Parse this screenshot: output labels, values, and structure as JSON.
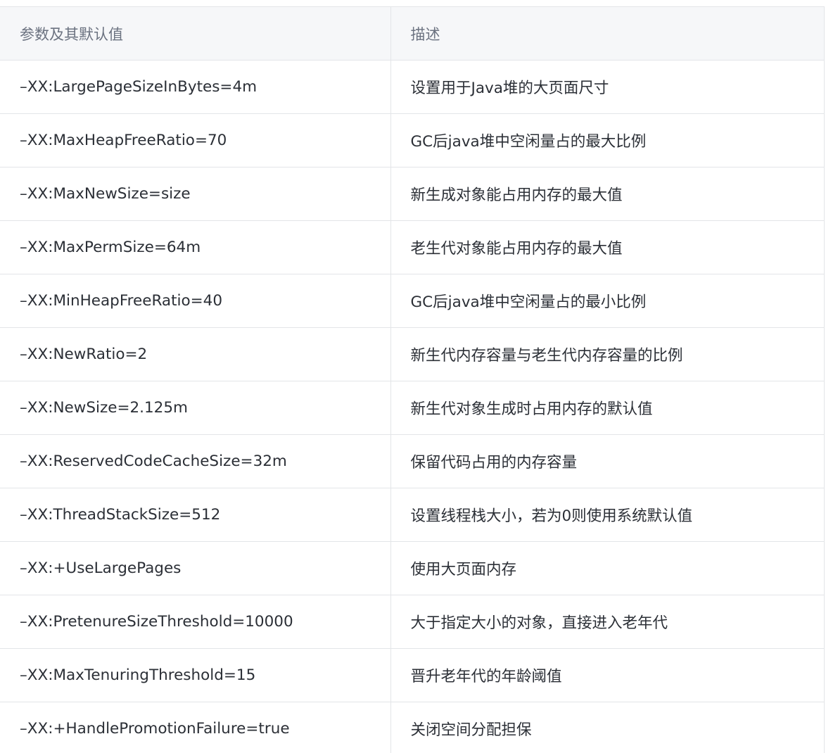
{
  "table": {
    "headers": [
      "参数及其默认值",
      "描述"
    ],
    "rows": [
      [
        "–XX:LargePageSizeInBytes=4m",
        "设置用于Java堆的大页面尺寸"
      ],
      [
        "–XX:MaxHeapFreeRatio=70",
        "GC后java堆中空闲量占的最大比例"
      ],
      [
        "–XX:MaxNewSize=size",
        "新生成对象能占用内存的最大值"
      ],
      [
        "–XX:MaxPermSize=64m",
        "老生代对象能占用内存的最大值"
      ],
      [
        "–XX:MinHeapFreeRatio=40",
        "GC后java堆中空闲量占的最小比例"
      ],
      [
        "–XX:NewRatio=2",
        "新生代内存容量与老生代内存容量的比例"
      ],
      [
        "–XX:NewSize=2.125m",
        "新生代对象生成时占用内存的默认值"
      ],
      [
        "–XX:ReservedCodeCacheSize=32m",
        "保留代码占用的内存容量"
      ],
      [
        "–XX:ThreadStackSize=512",
        "设置线程栈大小，若为0则使用系统默认值"
      ],
      [
        "–XX:+UseLargePages",
        "使用大页面内存"
      ],
      [
        "–XX:PretenureSizeThreshold=10000",
        "大于指定大小的对象，直接进入老年代"
      ],
      [
        "–XX:MaxTenuringThreshold=15",
        "晋升老年代的年龄阈值"
      ],
      [
        "–XX:+HandlePromotionFailure=true",
        "关闭空间分配担保"
      ]
    ]
  }
}
